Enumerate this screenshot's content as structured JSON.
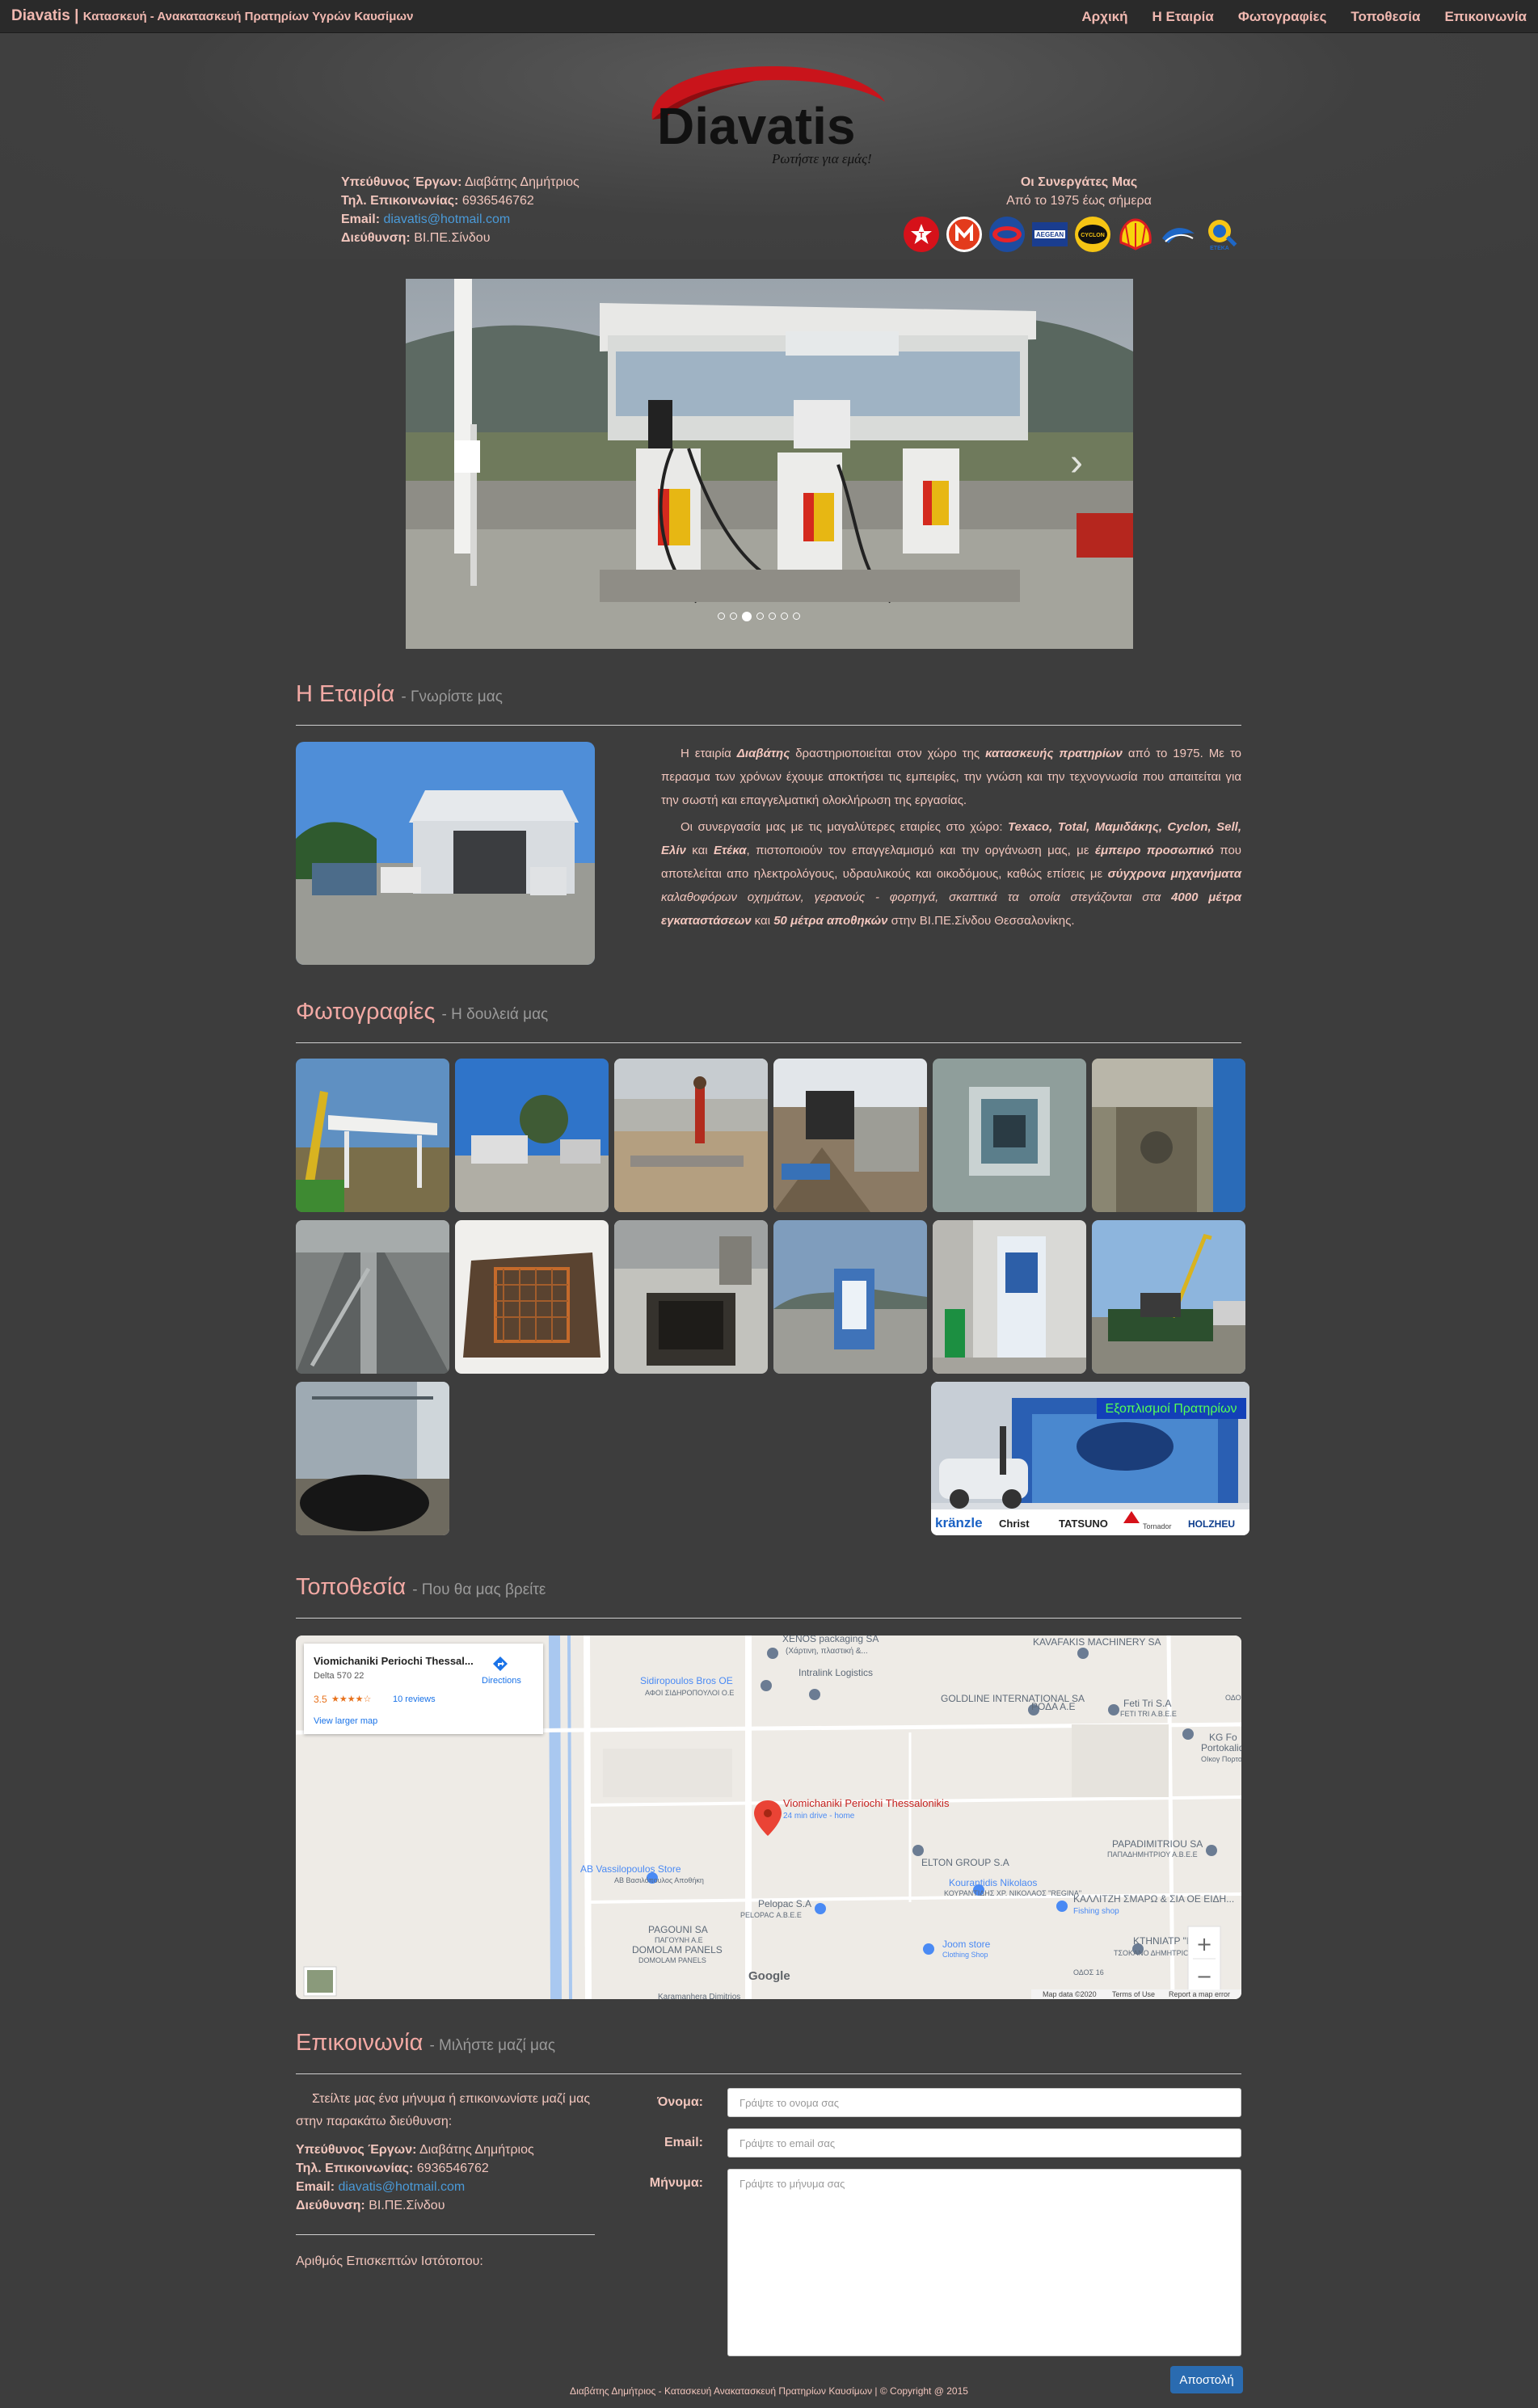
{
  "brand": {
    "name": "Diavatis",
    "separator": "|",
    "tagline": "Κατασκευή - Ανακατασκευή Πρατηρίων Υγρών Καυσίμων"
  },
  "nav": {
    "items": [
      "Αρχική",
      "Η Εταιρία",
      "Φωτογραφίες",
      "Τοποθεσία",
      "Επικοινωνία"
    ]
  },
  "logo": {
    "text": "Diavatis",
    "slogan": "Ρωτήστε για εμάς!"
  },
  "contact_info": {
    "manager_label": "Υπεύθυνος Έργων:",
    "manager": "Διαβάτης Δημήτριος",
    "phone_label": "Τηλ. Επικοινωνίας:",
    "phone": "6936546762",
    "email_label": "Email:",
    "email": "diavatis@hotmail.com",
    "address_label": "Διεύθυνση:",
    "address": "ΒΙ.ΠΕ.Σίνδου"
  },
  "partners": {
    "title": "Οι Συνεργάτες Μας",
    "subtitle": "Από το 1975 έως σήμερα",
    "logos": [
      "texaco-logo",
      "mamidakis-logo",
      "cyclon-logo",
      "aegean-logo",
      "cyclon-lubricants-logo",
      "shell-logo",
      "elin-logo",
      "eteka-logo"
    ]
  },
  "carousel": {
    "slide_count": 7,
    "active_index": 2,
    "prev_label": "‹",
    "next_label": "›"
  },
  "company": {
    "title": "Η Εταιρία",
    "subtitle": "- Γνωρίστε μας",
    "p1_a": "Η εταιρία ",
    "p1_b": "Διαβάτης",
    "p1_c": " δραστηριοποιείται στον χώρο της ",
    "p1_d": "κατασκευής πρατηρίων",
    "p1_e": " από το 1975. Με το περασμα των χρόνων έχουμε αποκτήσει τις εμπειρίες, την γνώση και την τεχνογνωσία που απαιτείται για την σωστή και επαγγελματική ολοκλήρωση της εργασίας.",
    "p2_a": "Οι συνεργασία μας με τις μαγαλύτερες εταιρίες στο χώρο: ",
    "p2_b": "Texaco, Total, Μαμιδάκης, Cyclon, Sell, Ελίν",
    "p2_c": " και ",
    "p2_d": "Ετέκα",
    "p2_e": ", πιστοποιούν τον επαγγελαμισμό και την οργάνωση μας, με ",
    "p2_f": "έμπειρο προσωπικό",
    "p2_g": " που αποτελείται απο ηλεκτρολόγους, υδραυλικούς και οικοδόμους, καθώς επίσεις με ",
    "p2_h": "σύγχρονα μηχανήματα",
    "p2_i": " καλαθοφόρων οχημάτων, γερανούς - φορτηγά, σκαπτικά τα οποία στεγάζονται στα ",
    "p2_j": "4000 μέτρα εγκαταστάσεων",
    "p2_k": " και ",
    "p2_l": "50 μέτρα αποθηκών",
    "p2_m": " στην ΒΙ.ΠΕ.Σίνδου Θεσσαλονίκης."
  },
  "photos": {
    "title": "Φωτογραφίες",
    "subtitle": "- Η δουλειά μας",
    "count": 13,
    "ad": {
      "banner": "Εξοπλισμοί Πρατηρίων",
      "brands": [
        "kränzle",
        "Christ",
        "TATSUNO",
        "Tornador",
        "HOLZHEU"
      ]
    }
  },
  "location": {
    "title": "Τοποθεσία",
    "subtitle": "- Που θα μας βρείτε",
    "map": {
      "place_name": "Viomichaniki Periochi Thessal...",
      "place_sub": "Delta 570 22",
      "rating": "3.5",
      "stars": "★★★★☆",
      "reviews": "10 reviews",
      "larger": "View larger map",
      "directions": "Directions",
      "pin_title": "Viomichaniki Periochi Thessalonikis",
      "pin_sub": "24 min drive - home",
      "labels": [
        "XENOS packaging SA",
        "(Χάρτινη, πλαστική &...",
        "KAVAFAKIS MACHINERY SA",
        "Intralink Logistics",
        "Sidiropoulos Bros OE",
        "ΑΦΟΙ ΣΙΔΗΡΟΠΟΥΛΟΙ Ο.Ε",
        "GOLDLINE INTERNATIONAL SA",
        "ΡΟΔΑ Α.Ε",
        "Feti Tri S.A",
        "FETI TRI A.B.E.E",
        "KG Fo",
        "Portokalidi E",
        "ΟΙκογ Πορτοκαλιδη",
        "ELTON GROUP S.A",
        "PAPADIMITRIOU SA",
        "ΠΑΠΑΔΗΜΗΤΡΙΟΥ Α.Β.Ε.Ε",
        "AB Vassilopoulos Store",
        "ΑΒ Βασιλόπουλος Αποθήκη",
        "Kourantidis Nikolaos",
        "ΚΟΥΡΑΝΤΙΔΗΣ ΧΡ. ΝΙΚΟΛΑΟΣ \"REGINA\"",
        "ΚΑΛΛΙΤΖΗ ΣΜΑΡΩ & ΣΙΑ ΟΕ ΕΙΔΗ...",
        "Fishing shop",
        "Pelopac S.A",
        "PELOPAC Α.Β.Ε.Ε",
        "PAGOUNI SA",
        "ΠΑΓΟΥΝΗ Α.Ε",
        "DOMOLAM PANELS",
        "DOMOLAM PANELS",
        "Joom store",
        "Clothing Shop",
        "ΚΤΗΝΙΑΤΡ \"HOME",
        "ΤΣΟΚΑΝΟ ΔΗΜΗΤΡΙΟΣ",
        "ΟΔΟΣ 16",
        "ΟΔΟΣ",
        "Karamanhera Dimitrios"
      ],
      "google": "Google",
      "map_data": "Map data ©2020",
      "terms": "Terms of Use",
      "report": "Report a map error",
      "zoom_in": "+",
      "zoom_out": "−"
    }
  },
  "contact": {
    "title": "Επικοινωνία",
    "subtitle": "- Μιλήστε μαζί μας",
    "intro": "Στείλτε μας ένα μήνυμα ή επικοινωνίστε μαζί μας στην παρακάτω διεύθυνση:",
    "visits_label": "Αριθμός Επισκεπτών Ιστότοπου:",
    "form": {
      "name_label": "Όνομα:",
      "name_placeholder": "Γράψτε το ονομα σας",
      "email_label": "Email:",
      "email_placeholder": "Γράψτε το email σας",
      "message_label": "Μήνυμα:",
      "message_placeholder": "Γράψτε το μήνυμα σας",
      "submit": "Αποστολή"
    }
  },
  "footer": {
    "text": "Διαβάτης Δημήτριος - Κατασκευή Ανακατασκευή Πρατηρίων Καυσίμων | © Copyright @ 2015"
  }
}
